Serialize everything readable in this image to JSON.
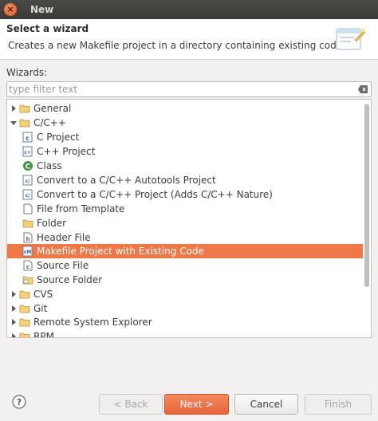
{
  "window": {
    "title": "New",
    "close_glyph": "×"
  },
  "header": {
    "title": "Select a wizard",
    "description": "Creates a new Makefile project in a directory containing existing code"
  },
  "wizards_label": "Wizards:",
  "filter": {
    "placeholder": "type filter text",
    "value": ""
  },
  "tree": {
    "rows": [
      {
        "label": "General",
        "expanded": false,
        "icon": "folder-icon"
      },
      {
        "label": "C/C++",
        "expanded": true,
        "icon": "folder-icon"
      },
      {
        "label": "C Project",
        "icon": "c-project-icon"
      },
      {
        "label": "C++ Project",
        "icon": "cpp-project-icon"
      },
      {
        "label": "Class",
        "icon": "class-icon"
      },
      {
        "label": "Convert to a C/C++ Autotools Project",
        "icon": "convert-icon"
      },
      {
        "label": "Convert to a C/C++ Project (Adds C/C++ Nature)",
        "icon": "convert-icon"
      },
      {
        "label": "File from Template",
        "icon": "file-icon"
      },
      {
        "label": "Folder",
        "icon": "folder-icon"
      },
      {
        "label": "Header File",
        "icon": "header-file-icon"
      },
      {
        "label": "Makefile Project with Existing Code",
        "icon": "makefile-project-icon",
        "selected": true
      },
      {
        "label": "Source File",
        "icon": "source-file-icon"
      },
      {
        "label": "Source Folder",
        "icon": "source-folder-icon"
      },
      {
        "label": "CVS",
        "expanded": false,
        "icon": "folder-icon"
      },
      {
        "label": "Git",
        "expanded": false,
        "icon": "folder-icon"
      },
      {
        "label": "Remote System Explorer",
        "expanded": false,
        "icon": "folder-icon"
      },
      {
        "label": "RPM",
        "expanded": false,
        "icon": "folder-icon"
      }
    ]
  },
  "buttons": {
    "back": "< Back",
    "next": "Next >",
    "cancel": "Cancel",
    "finish": "Finish"
  },
  "colors": {
    "selection": "#f07746",
    "accent": "#e8643a"
  }
}
